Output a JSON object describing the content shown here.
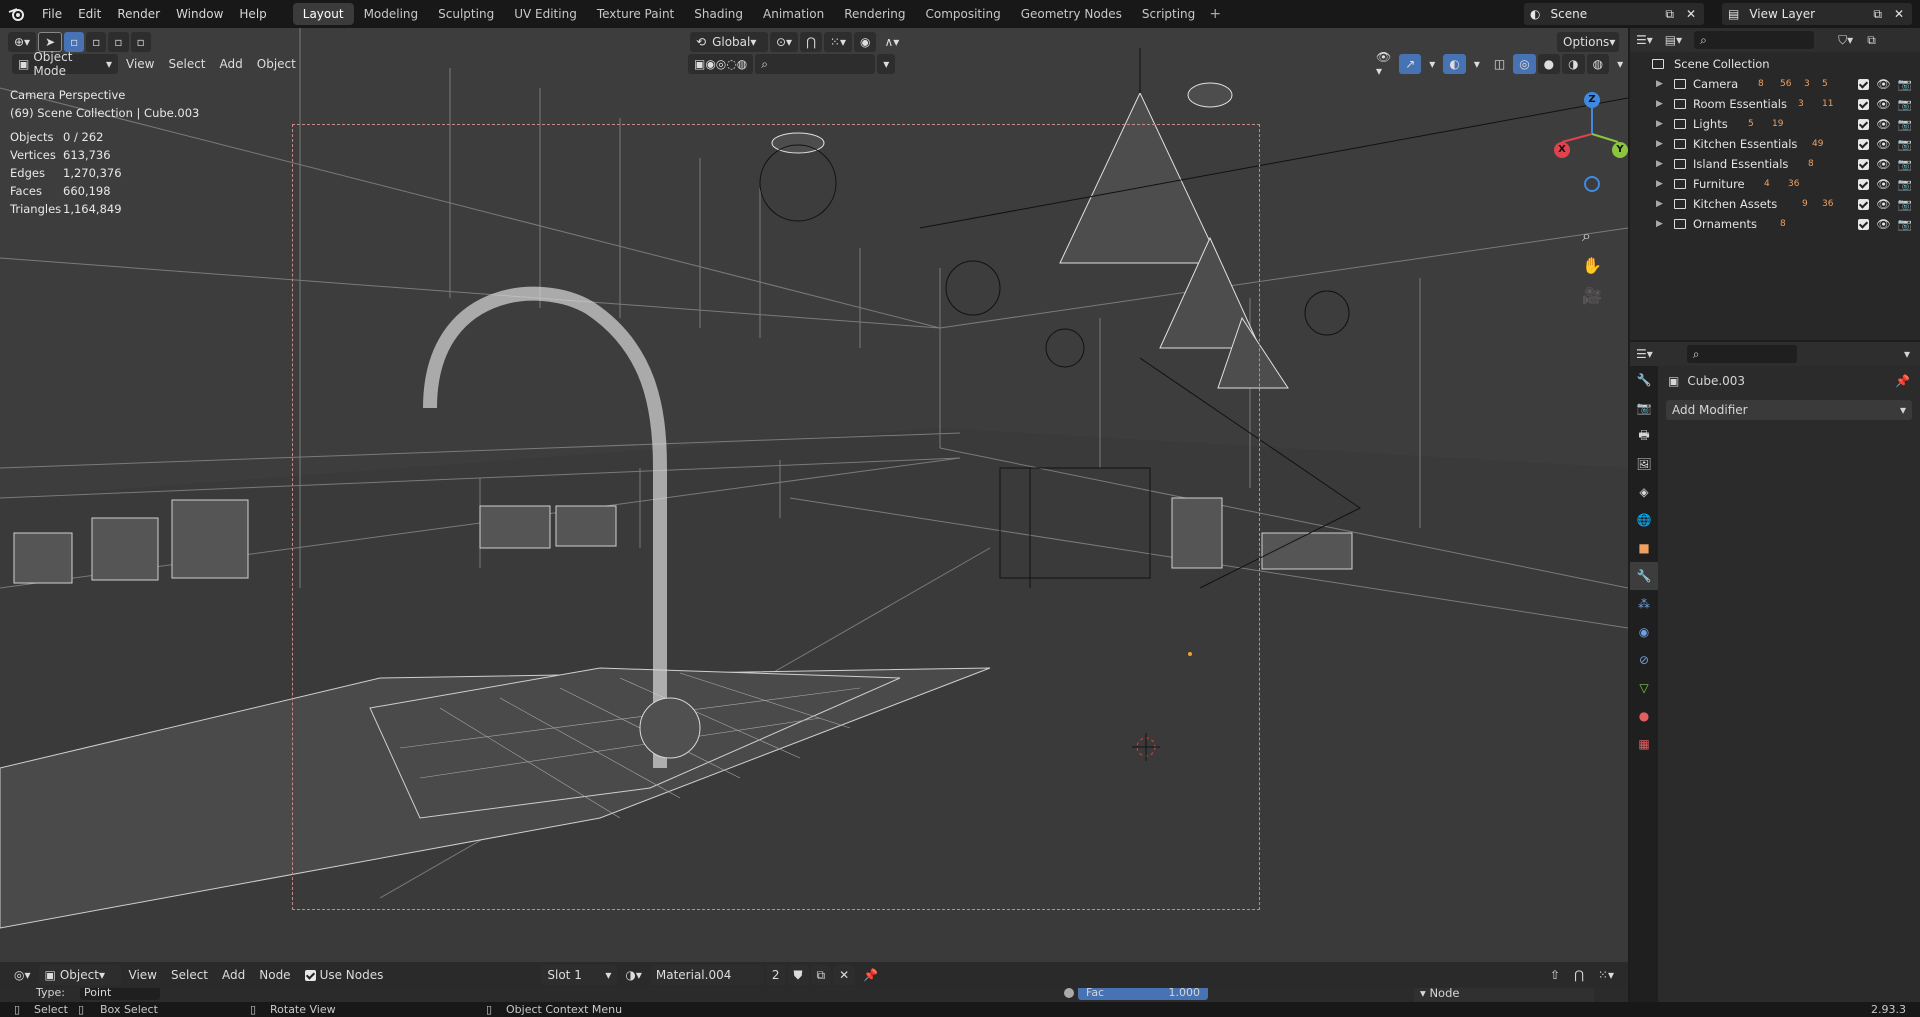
{
  "topbar": {
    "menus": [
      "File",
      "Edit",
      "Render",
      "Window",
      "Help"
    ],
    "workspaces": [
      "Layout",
      "Modeling",
      "Sculpting",
      "UV Editing",
      "Texture Paint",
      "Shading",
      "Animation",
      "Rendering",
      "Compositing",
      "Geometry Nodes",
      "Scripting"
    ],
    "add_workspace": "+",
    "scene_name": "Scene",
    "view_layer_name": "View Layer"
  },
  "viewport": {
    "transform_orientation": "Global",
    "options_label": "Options",
    "mode": "Object Mode",
    "menus": [
      "View",
      "Select",
      "Add",
      "Object"
    ],
    "overlay_title": "Camera Perspective",
    "overlay_collection": "(69) Scene Collection | Cube.003",
    "stats": [
      {
        "label": "Objects",
        "value": "0 / 262"
      },
      {
        "label": "Vertices",
        "value": "613,736"
      },
      {
        "label": "Edges",
        "value": "1,270,376"
      },
      {
        "label": "Faces",
        "value": "660,198"
      },
      {
        "label": "Triangles",
        "value": "1,164,849"
      }
    ],
    "gizmo": {
      "x": "X",
      "y": "Y",
      "z": "Z"
    }
  },
  "outliner": {
    "root": "Scene Collection",
    "items": [
      {
        "label": "Camera",
        "badges": [
          "8",
          "56",
          "3",
          "5"
        ]
      },
      {
        "label": "Room Essentials",
        "badges": [
          "3",
          "11"
        ]
      },
      {
        "label": "Lights",
        "badges": [
          "5",
          "19"
        ]
      },
      {
        "label": "Kitchen Essentials",
        "badges": [
          "49"
        ]
      },
      {
        "label": "Island Essentials",
        "badges": [
          "8"
        ]
      },
      {
        "label": "Furniture",
        "badges": [
          "4",
          "36"
        ]
      },
      {
        "label": "Kitchen Assets",
        "badges": [
          "9",
          "36"
        ]
      },
      {
        "label": "Ornaments",
        "badges": [
          "8"
        ]
      }
    ]
  },
  "properties": {
    "object_name": "Cube.003",
    "add_modifier": "Add Modifier"
  },
  "node_editor": {
    "type": "Object",
    "menus": [
      "View",
      "Select",
      "Add",
      "Node"
    ],
    "use_nodes": "Use Nodes",
    "slot": "Slot 1",
    "material": "Material.004",
    "users": "2",
    "type_label": "Type:",
    "type_value": "Point",
    "fac_label": "Fac",
    "fac_value": "1.000",
    "node_panel": "Node"
  },
  "statusbar": {
    "select": "Select",
    "box_select": "Box Select",
    "rotate_view": "Rotate View",
    "context_menu": "Object Context Menu",
    "version": "2.93.3"
  },
  "colors": {
    "accent": "#4772b3",
    "viewport_bg": "#3d3d3d",
    "badge": "#f0a060",
    "gizmo_x": "#e0434f",
    "gizmo_y": "#8cc63f",
    "gizmo_z": "#3f8ae0"
  }
}
